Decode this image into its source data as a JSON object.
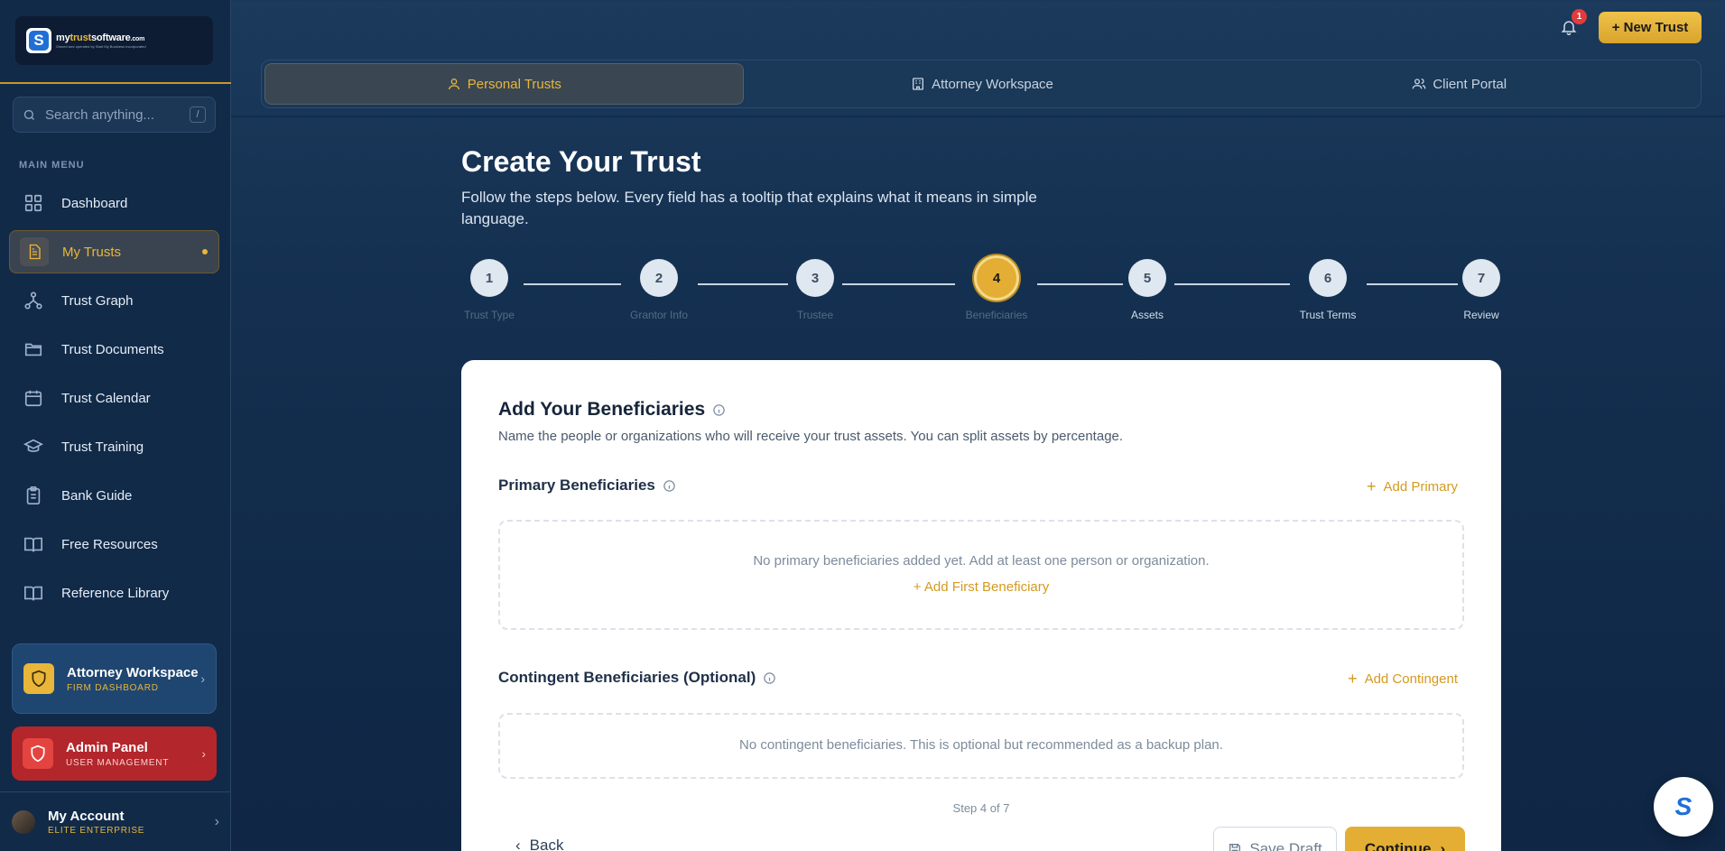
{
  "brand": {
    "logo_letter": "S",
    "name_part1": "my",
    "name_part2": "trust",
    "name_part3": "software",
    "name_suffix": ".com",
    "tagline": "Owned and operated by Start My Business Incorporated"
  },
  "sidebar": {
    "search_placeholder": "Search anything...",
    "search_shortcut": "/",
    "menu_label": "MAIN MENU",
    "items": [
      {
        "label": "Dashboard",
        "icon": "grid-icon"
      },
      {
        "label": "My Trusts",
        "icon": "document-icon",
        "active": true
      },
      {
        "label": "Trust Graph",
        "icon": "graph-icon"
      },
      {
        "label": "Trust Documents",
        "icon": "folder-icon"
      },
      {
        "label": "Trust Calendar",
        "icon": "calendar-icon"
      },
      {
        "label": "Trust Training",
        "icon": "graduation-cap-icon"
      },
      {
        "label": "Bank Guide",
        "icon": "clipboard-icon"
      },
      {
        "label": "Free Resources",
        "icon": "book-open-icon"
      },
      {
        "label": "Reference Library",
        "icon": "book-icon"
      }
    ],
    "attorney": {
      "title": "Attorney Workspace",
      "subtitle": "FIRM DASHBOARD"
    },
    "admin": {
      "title": "Admin Panel",
      "subtitle": "USER MANAGEMENT"
    },
    "account": {
      "name": "My Account",
      "plan": "ELITE ENTERPRISE"
    }
  },
  "topbar": {
    "notification_count": "1",
    "new_trust_label": "+ New Trust"
  },
  "tabs": [
    {
      "label": "Personal Trusts",
      "active": true
    },
    {
      "label": "Attorney Workspace"
    },
    {
      "label": "Client Portal"
    }
  ],
  "page": {
    "title": "Create Your Trust",
    "subtitle": "Follow the steps below. Every field has a tooltip that explains what it means in simple language."
  },
  "steps": [
    {
      "num": "1",
      "label": "Trust Type"
    },
    {
      "num": "2",
      "label": "Grantor Info"
    },
    {
      "num": "3",
      "label": "Trustee"
    },
    {
      "num": "4",
      "label": "Beneficiaries",
      "current": true
    },
    {
      "num": "5",
      "label": "Assets"
    },
    {
      "num": "6",
      "label": "Trust Terms"
    },
    {
      "num": "7",
      "label": "Review"
    }
  ],
  "card": {
    "title": "Add Your Beneficiaries",
    "subtitle": "Name the people or organizations who will receive your trust assets. You can split assets by percentage.",
    "primary": {
      "title": "Primary Beneficiaries",
      "add_label": "Add Primary",
      "empty_text": "No primary beneficiaries added yet. Add at least one person or organization.",
      "empty_cta": "+ Add First Beneficiary"
    },
    "contingent": {
      "title": "Contingent Beneficiaries (Optional)",
      "add_label": "Add Contingent",
      "empty_text": "No contingent beneficiaries. This is optional but recommended as a backup plan."
    },
    "step_count": "Step 4 of 7",
    "back_label": "Back",
    "save_draft_label": "Save Draft",
    "continue_label": "Continue"
  },
  "chat_fab": {
    "letter": "S"
  },
  "colors": {
    "accent_gold": "#e3ae33",
    "sidebar_bg": "#112a48",
    "admin_red": "#b3262b"
  }
}
